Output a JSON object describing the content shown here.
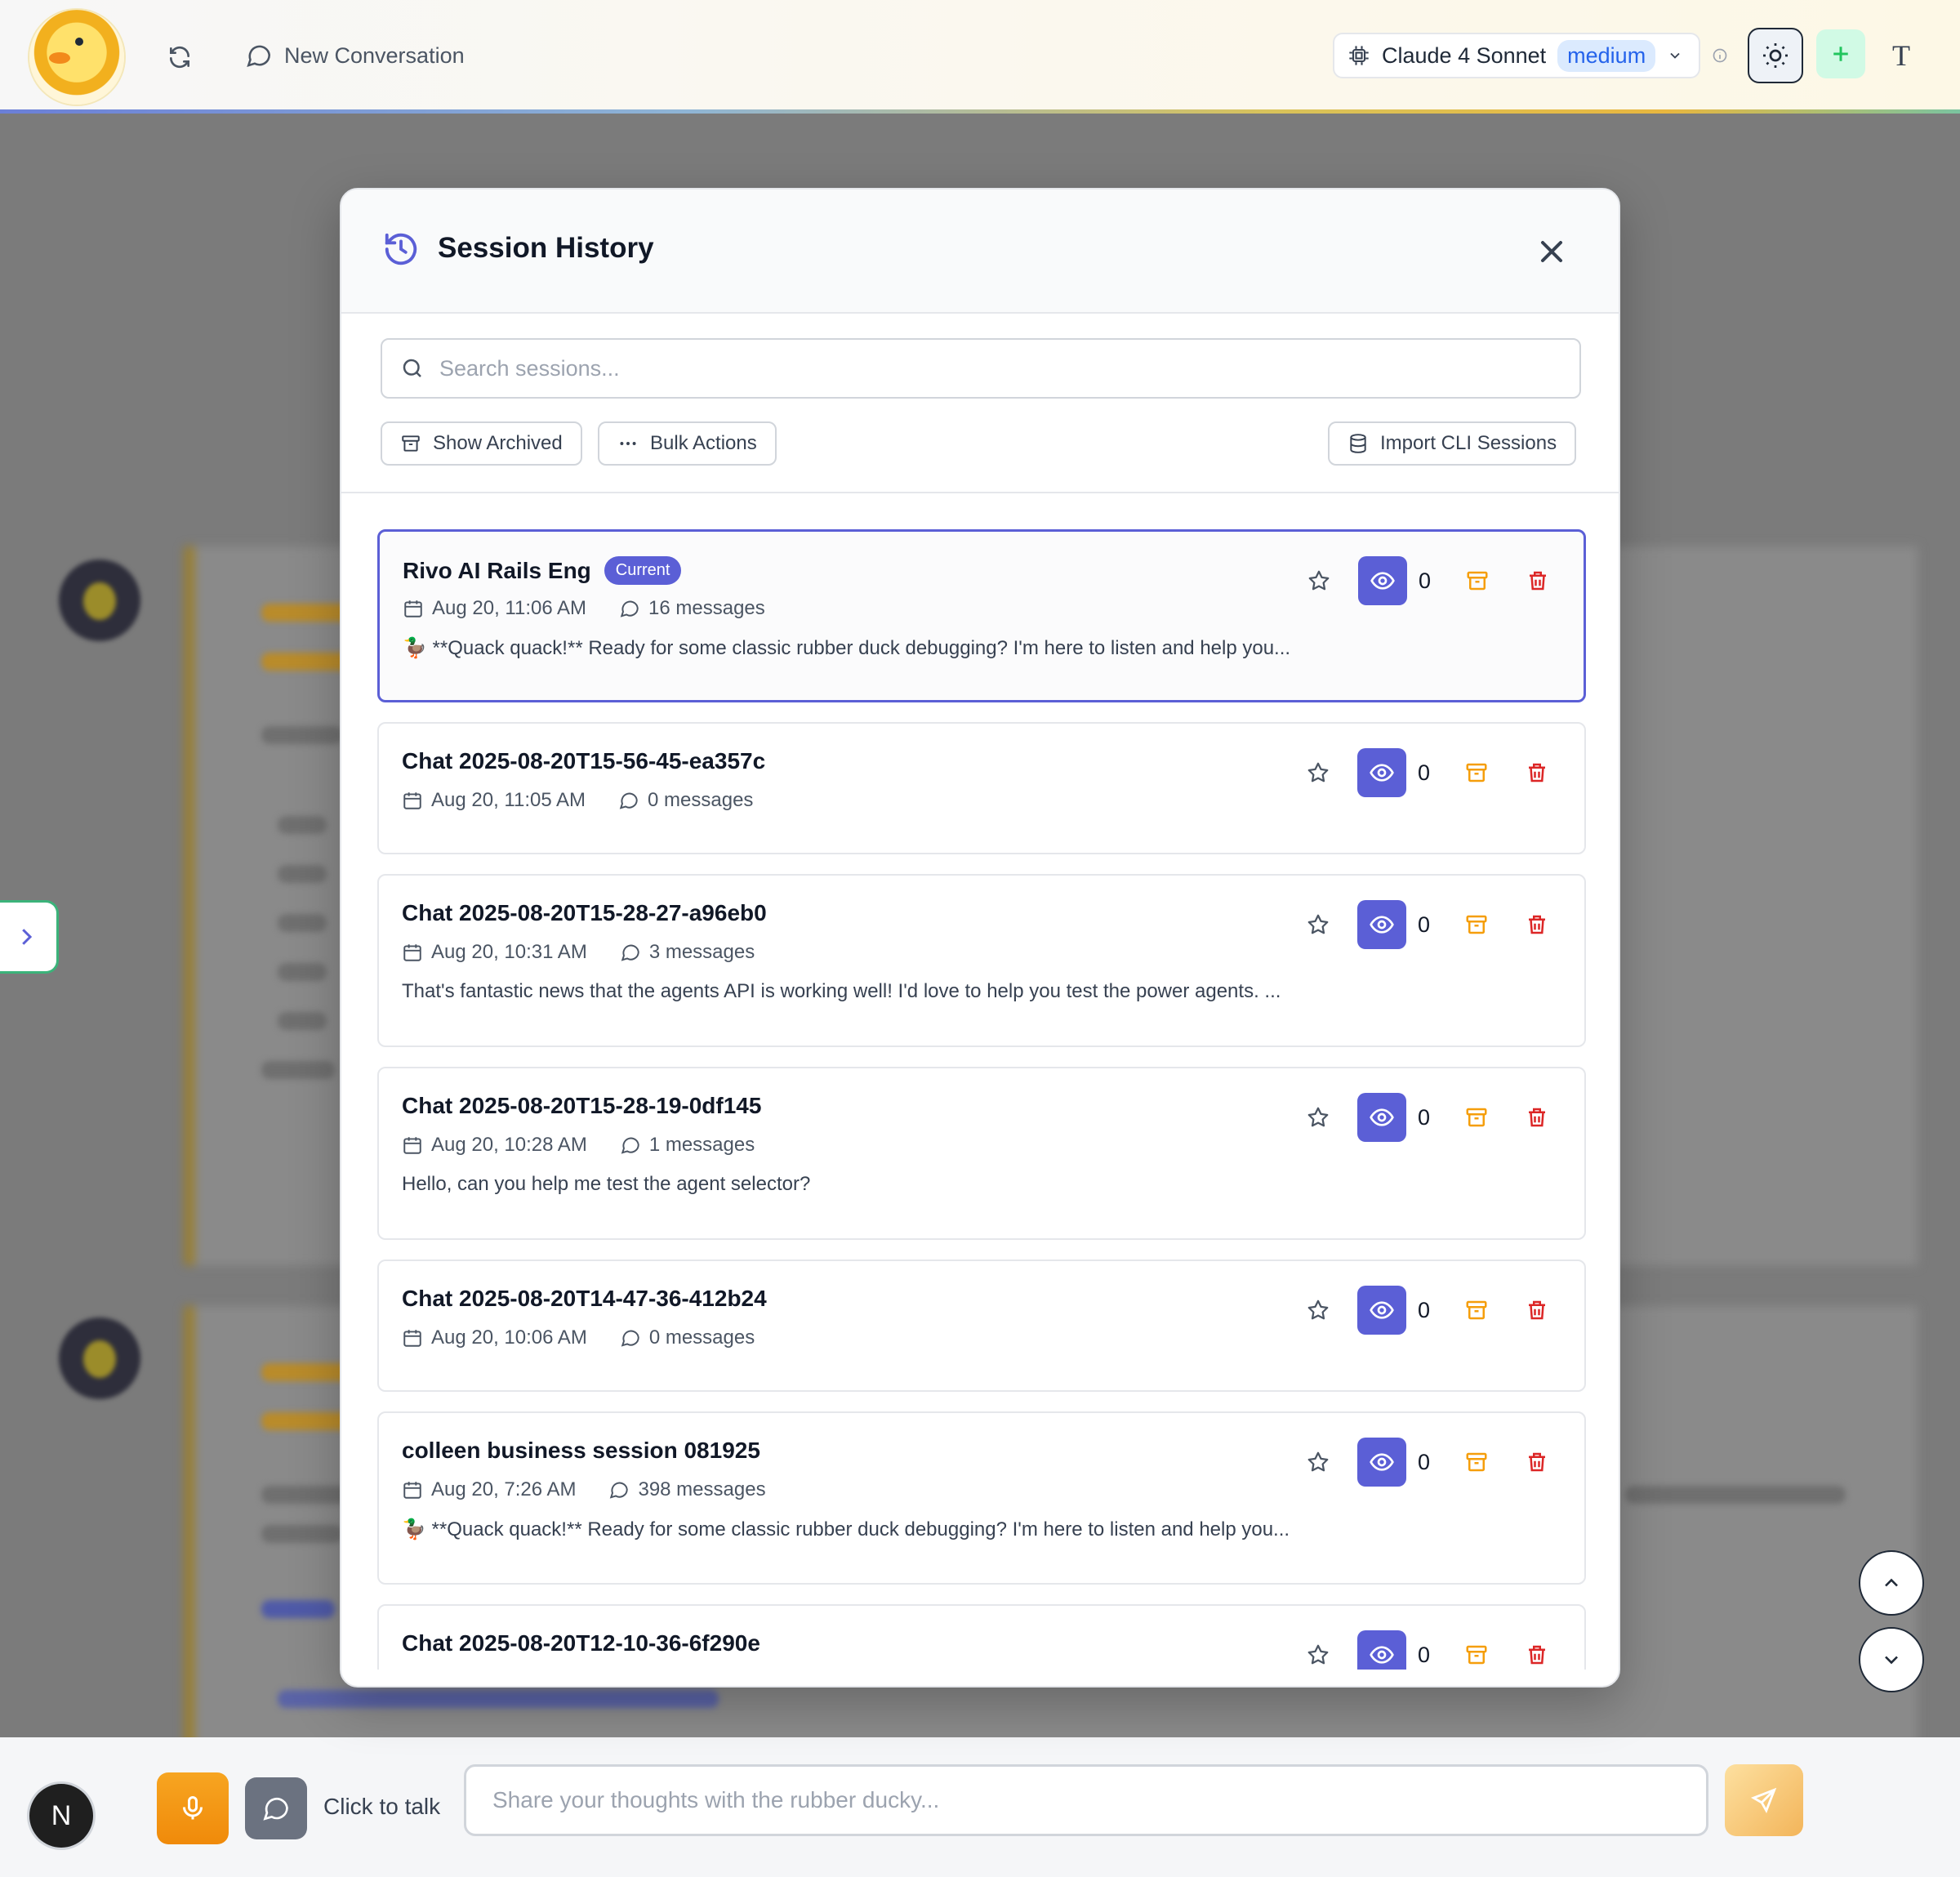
{
  "header": {
    "new_conversation_label": "New Conversation",
    "model_name": "Claude 4 Sonnet",
    "model_effort": "medium"
  },
  "modal": {
    "title": "Session History",
    "search_placeholder": "Search sessions...",
    "show_archived_label": "Show Archived",
    "bulk_actions_label": "Bulk Actions",
    "import_cli_label": "Import CLI Sessions",
    "current_badge": "Current",
    "sessions": [
      {
        "title": "Rivo AI Rails Eng",
        "date": "Aug 20, 11:06 AM",
        "messages": "16 messages",
        "preview": "🦆 **Quack quack!** Ready for some classic rubber duck debugging? I'm here to listen and help you...",
        "count": "0",
        "current": true
      },
      {
        "title": "Chat 2025-08-20T15-56-45-ea357c",
        "date": "Aug 20, 11:05 AM",
        "messages": "0 messages",
        "preview": "",
        "count": "0"
      },
      {
        "title": "Chat 2025-08-20T15-28-27-a96eb0",
        "date": "Aug 20, 10:31 AM",
        "messages": "3 messages",
        "preview": "That's fantastic news that the agents API is working well! I'd love to help you test the power agents. ...",
        "count": "0"
      },
      {
        "title": "Chat 2025-08-20T15-28-19-0df145",
        "date": "Aug 20, 10:28 AM",
        "messages": "1 messages",
        "preview": "Hello, can you help me test the agent selector?",
        "count": "0"
      },
      {
        "title": "Chat 2025-08-20T14-47-36-412b24",
        "date": "Aug 20, 10:06 AM",
        "messages": "0 messages",
        "preview": "",
        "count": "0"
      },
      {
        "title": "colleen business session 081925",
        "date": "Aug 20, 7:26 AM",
        "messages": "398 messages",
        "preview": "🦆 **Quack quack!** Ready for some classic rubber duck debugging? I'm here to listen and help you...",
        "count": "0"
      },
      {
        "title": "Chat 2025-08-20T12-10-36-6f290e",
        "date": "",
        "messages": "",
        "preview": "",
        "count": "0"
      }
    ]
  },
  "footer": {
    "user_initial": "N",
    "click_to_talk_label": "Click to talk",
    "message_placeholder": "Share your thoughts with the rubber ducky..."
  },
  "icons": {
    "refresh": "refresh-icon",
    "chat": "chat-bubble-icon",
    "chip": "chip-icon",
    "sun": "sun-icon",
    "plus": "plus-icon",
    "font": "font-icon",
    "history": "history-icon",
    "close": "close-icon",
    "search": "search-icon",
    "archive": "archive-icon",
    "dots": "dots-icon",
    "database": "database-icon",
    "calendar": "calendar-icon",
    "star": "star-icon",
    "eye": "eye-icon",
    "trash": "trash-icon",
    "mic": "microphone-icon",
    "send": "send-icon"
  },
  "colors": {
    "accent": "#5b5fd6",
    "archive": "#f59e0b",
    "delete": "#dc2626",
    "mic": "#f59e0b",
    "new_chat": "#22c55e"
  }
}
